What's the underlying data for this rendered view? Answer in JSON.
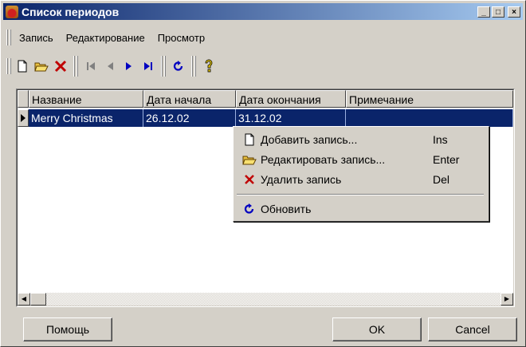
{
  "window": {
    "title": "Список периодов",
    "controls": {
      "minimize": "_",
      "maximize": "□",
      "close": "×"
    }
  },
  "menu": {
    "items": [
      "Запись",
      "Редактирование",
      "Просмотр"
    ]
  },
  "toolbar": {
    "icons": [
      "new-document-icon",
      "open-folder-icon",
      "delete-x-icon",
      "first-record-icon",
      "prev-record-icon",
      "next-record-icon",
      "last-record-icon",
      "refresh-icon",
      "help-key-icon"
    ]
  },
  "grid": {
    "columns": [
      "Название",
      "Дата начала",
      "Дата окончания",
      "Примечание"
    ],
    "rows": [
      {
        "name": "Merry Christmas",
        "start": "26.12.02",
        "end": "31.12.02",
        "note": ""
      }
    ]
  },
  "context_menu": {
    "items": [
      {
        "label": "Добавить запись...",
        "key": "Ins",
        "icon": "new-document-icon"
      },
      {
        "label": "Редактировать запись...",
        "key": "Enter",
        "icon": "open-folder-icon"
      },
      {
        "label": "Удалить запись",
        "key": "Del",
        "icon": "delete-x-icon"
      },
      {
        "label": "Обновить",
        "key": "",
        "icon": "refresh-icon"
      }
    ]
  },
  "buttons": {
    "help": "Помощь",
    "ok": "OK",
    "cancel": "Cancel"
  },
  "colors": {
    "titlebar_start": "#0a246a",
    "titlebar_end": "#a6caf0",
    "selection": "#0a246a",
    "face": "#d4d0c8"
  }
}
